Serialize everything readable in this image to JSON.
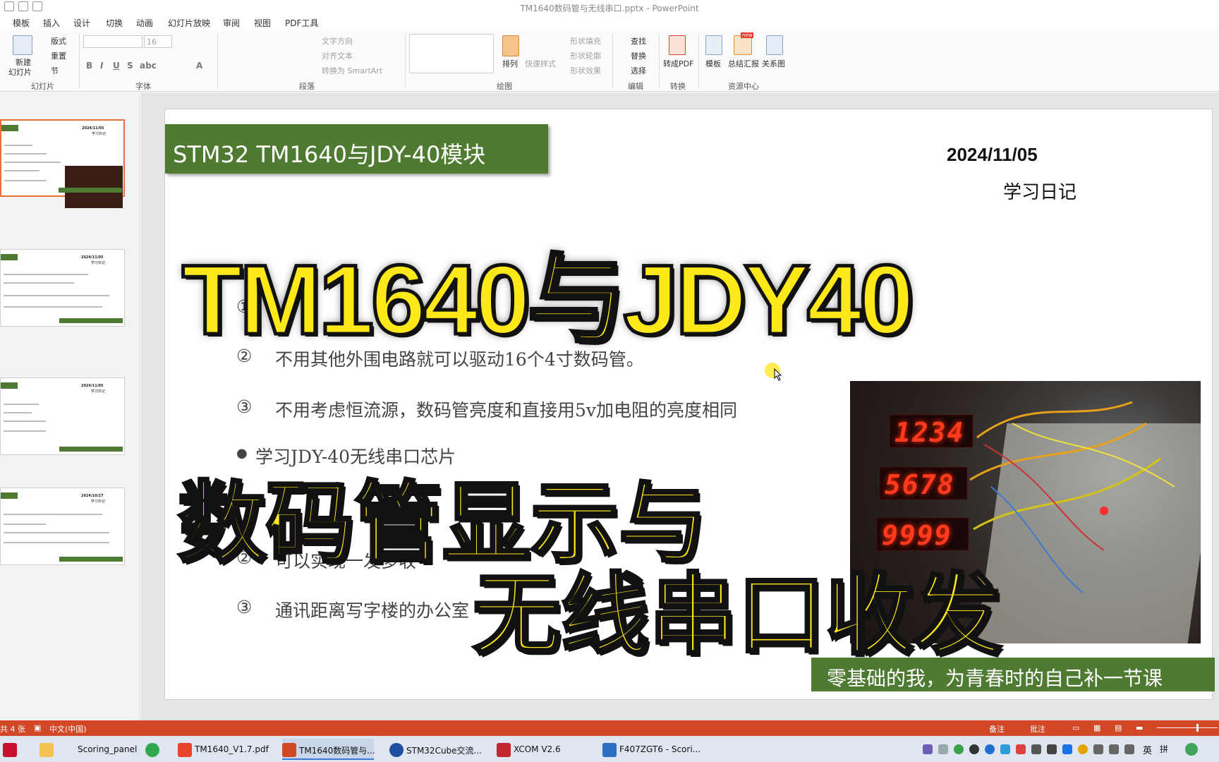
{
  "window": {
    "title": "TM1640数码管与无线串口.pptx - PowerPoint"
  },
  "menu": [
    "模板",
    "插入",
    "设计",
    "切换",
    "动画",
    "幻灯片放映",
    "审阅",
    "视图",
    "PDF工具"
  ],
  "ribbon": {
    "slides_group": {
      "new_slide": "新建",
      "new_slide2": "幻灯片",
      "layout": "版式",
      "reset": "重置",
      "section": "节",
      "label": "幻灯片"
    },
    "font_group": {
      "font_size": "16",
      "label": "字体"
    },
    "paragraph_group": {
      "text_direction": "文字方向",
      "align_text": "对齐文本",
      "smartart": "转换为 SmartArt",
      "label": "段落"
    },
    "drawing_group": {
      "arrange": "排列",
      "quick_styles": "快速样式",
      "shape_fill": "形状填充",
      "shape_outline": "形状轮廓",
      "shape_effects": "形状效果",
      "label": "绘图"
    },
    "editing_group": {
      "find": "查找",
      "replace": "替换",
      "select": "选择",
      "label": "编辑"
    },
    "convert_group": {
      "to_pdf": "转成PDF",
      "label": "转换"
    },
    "resource_group": {
      "template": "模板",
      "summary": "总结汇报",
      "relation": "关系图",
      "label": "资源中心",
      "new_badge": "new"
    }
  },
  "thumbnails": [
    {
      "date": "2024/11/05",
      "sub": "学习日记"
    },
    {
      "date": "2024/11/05",
      "sub": "学习日记"
    },
    {
      "date": "2024/11/05",
      "sub": "学习日记"
    },
    {
      "date": "2024/10/27",
      "sub": "学习日记"
    }
  ],
  "slide": {
    "header": "STM32 TM1640与JDY-40模块",
    "date": "2024/11/05",
    "diary": "学习日记",
    "items": [
      {
        "num": "①",
        "text": ""
      },
      {
        "num": "②",
        "text": "不用其他外围电路就可以驱动16个4寸数码管。"
      },
      {
        "num": "③",
        "text": "不用考虑恒流源，数码管亮度和直接用5v加电阻的亮度相同"
      },
      {
        "num": "●",
        "text": "学习JDY-40无线串口芯片"
      },
      {
        "num": "②",
        "text": "可以实现一发多收"
      },
      {
        "num": "③",
        "text": "通讯距离写字楼的办公室"
      }
    ],
    "photo_digits": [
      "1234",
      "5678",
      "9999"
    ],
    "footer": "零基础的我，为青春时的自己补一节课"
  },
  "overlay": {
    "line1": "TM1640与JDY40",
    "line2": "数码管显示与",
    "line3": "无线串口收发"
  },
  "status": {
    "slide_count": "共 4 张",
    "language": "中文(中国)",
    "notes": "备注",
    "comments": "批注"
  },
  "taskbar": [
    {
      "label": "Scoring_panel"
    },
    {
      "label": "TM1640_V1.7.pdf"
    },
    {
      "label": "TM1640数码管与..."
    },
    {
      "label": "STM32Cube交流..."
    },
    {
      "label": "XCOM V2.6"
    },
    {
      "label": "F407ZGT6 - Scori..."
    }
  ],
  "tray": {
    "ime": "英",
    "ime2": "拼"
  }
}
